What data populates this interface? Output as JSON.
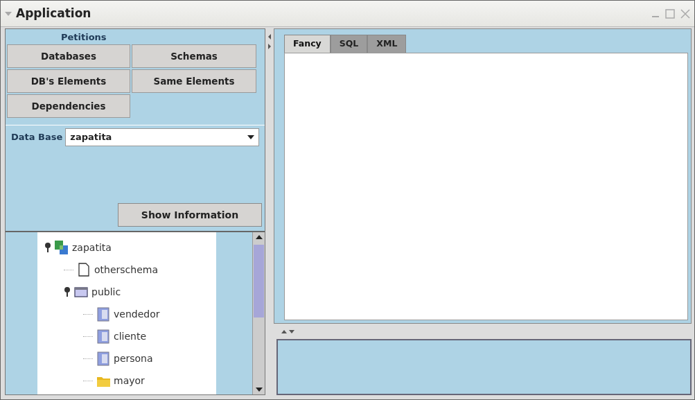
{
  "window": {
    "title": "Application",
    "expanded": true
  },
  "petitions": {
    "title": "Petitions",
    "buttons": [
      "Databases",
      "Schemas",
      "DB's Elements",
      "Same Elements",
      "Dependencies"
    ]
  },
  "database": {
    "label": "Data Base",
    "value": "zapatita"
  },
  "show_button": "Show Information",
  "tree": [
    {
      "label": "zapatita",
      "kind": "database",
      "expanded": true,
      "children": [
        {
          "label": "otherschema",
          "kind": "file"
        },
        {
          "label": "public",
          "kind": "schema",
          "expanded": true,
          "children": [
            {
              "label": "vendedor",
              "kind": "table"
            },
            {
              "label": "cliente",
              "kind": "table"
            },
            {
              "label": "persona",
              "kind": "table"
            },
            {
              "label": "mayor",
              "kind": "folder"
            }
          ]
        }
      ]
    }
  ],
  "tabs": [
    {
      "label": "Fancy",
      "selected": true
    },
    {
      "label": "SQL",
      "selected": false
    },
    {
      "label": "XML",
      "selected": false
    }
  ]
}
